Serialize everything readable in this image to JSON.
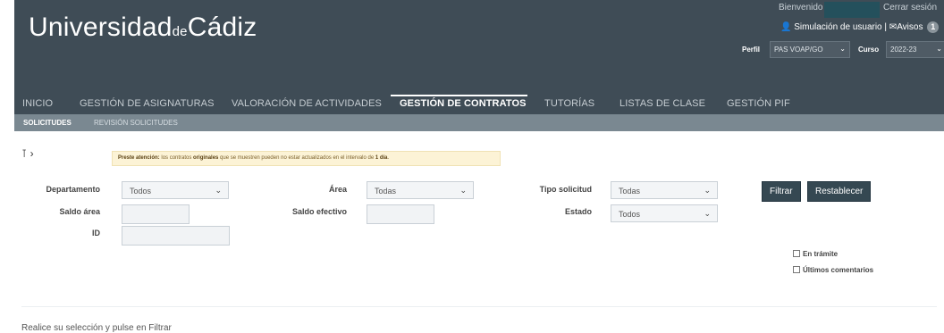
{
  "header": {
    "logo_main": "Universidad",
    "logo_de": "de",
    "logo_end": "Cádiz",
    "welcome": "Bienvenido",
    "logout": "Cerrar sesión",
    "simulation": "Simulación de usuario",
    "notices_label": "Avisos",
    "notices_count": "1",
    "perfil_label": "Perfil",
    "perfil_value": "PAS VOAP/GO",
    "curso_label": "Curso",
    "curso_value": "2022-23",
    "colors": {
      "header_bg": "#3f4c56",
      "subnav_bg": "#7a8891"
    }
  },
  "nav": {
    "items": [
      {
        "label": "INICIO"
      },
      {
        "label": "GESTIÓN DE ASIGNATURAS"
      },
      {
        "label": "VALORACIÓN DE ACTIVIDADES"
      },
      {
        "label": "GESTIÓN DE CONTRATOS",
        "active": true
      },
      {
        "label": "TUTORÍAS"
      },
      {
        "label": "LISTAS DE CLASE"
      },
      {
        "label": "GESTIÓN PIF"
      }
    ]
  },
  "subnav": {
    "items": [
      {
        "label": "SOLICITUDES",
        "active": true
      },
      {
        "label": "REVISIÓN SOLICITUDES"
      }
    ]
  },
  "notice": {
    "prefix": "Preste atención:",
    "text1": " los contratos ",
    "bold1": "originales",
    "text2": " que se muestren pueden no estar actualizados en el intervalo de ",
    "bold2": "1 día",
    "text3": "."
  },
  "filters": {
    "departamento_label": "Departamento",
    "departamento_value": "Todos",
    "area_label": "Área",
    "area_value": "Todas",
    "tipo_label": "Tipo solicitud",
    "tipo_value": "Todas",
    "saldo_area_label": "Saldo área",
    "saldo_area_value": "",
    "saldo_efectivo_label": "Saldo efectivo",
    "saldo_efectivo_value": "",
    "estado_label": "Estado",
    "estado_value": "Todos",
    "id_label": "ID",
    "id_value": "",
    "filtrar": "Filtrar",
    "restablecer": "Restablecer",
    "en_tramite": "En trámite",
    "ultimos_comentarios": "Últimos comentarios"
  },
  "footer": {
    "note": "Realice su selección y pulse en Filtrar"
  }
}
